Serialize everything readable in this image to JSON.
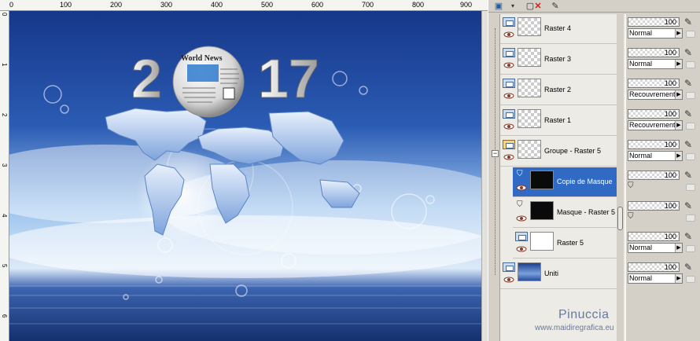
{
  "ruler": {
    "top_labels": [
      "0",
      "100",
      "200",
      "300",
      "400",
      "500",
      "600",
      "700",
      "800",
      "900"
    ],
    "left_labels": [
      "0",
      "1",
      "2",
      "3",
      "4",
      "5",
      "6"
    ]
  },
  "artwork": {
    "year_left": "2",
    "year_right": "17",
    "globe_text": "World News"
  },
  "layers": [
    {
      "name": "Raster 4",
      "type": "raster",
      "opacity": "100",
      "blend": "Normal"
    },
    {
      "name": "Raster 3",
      "type": "raster",
      "opacity": "100",
      "blend": "Normal"
    },
    {
      "name": "Raster 2",
      "type": "raster",
      "opacity": "100",
      "blend": "Recouvrement"
    },
    {
      "name": "Raster 1",
      "type": "raster",
      "opacity": "100",
      "blend": "Recouvrement"
    },
    {
      "name": "Groupe - Raster 5",
      "type": "group",
      "opacity": "100",
      "blend": "Normal"
    },
    {
      "name": "Copie de Masque",
      "type": "mask",
      "opacity": "100",
      "blend": "",
      "selected": true
    },
    {
      "name": "Masque - Raster 5",
      "type": "mask",
      "opacity": "100",
      "blend": ""
    },
    {
      "name": "Raster 5",
      "type": "raster",
      "opacity": "100",
      "blend": "Normal"
    },
    {
      "name": "Uniti",
      "type": "raster",
      "opacity": "100",
      "blend": "Normal"
    }
  ],
  "watermark": {
    "name": "Pinuccia",
    "site": "www.maidiregrafica.eu"
  },
  "colors": {
    "selection": "#316ac5",
    "sky_top": "#1a3c8c",
    "sea": "#1e3f86"
  }
}
